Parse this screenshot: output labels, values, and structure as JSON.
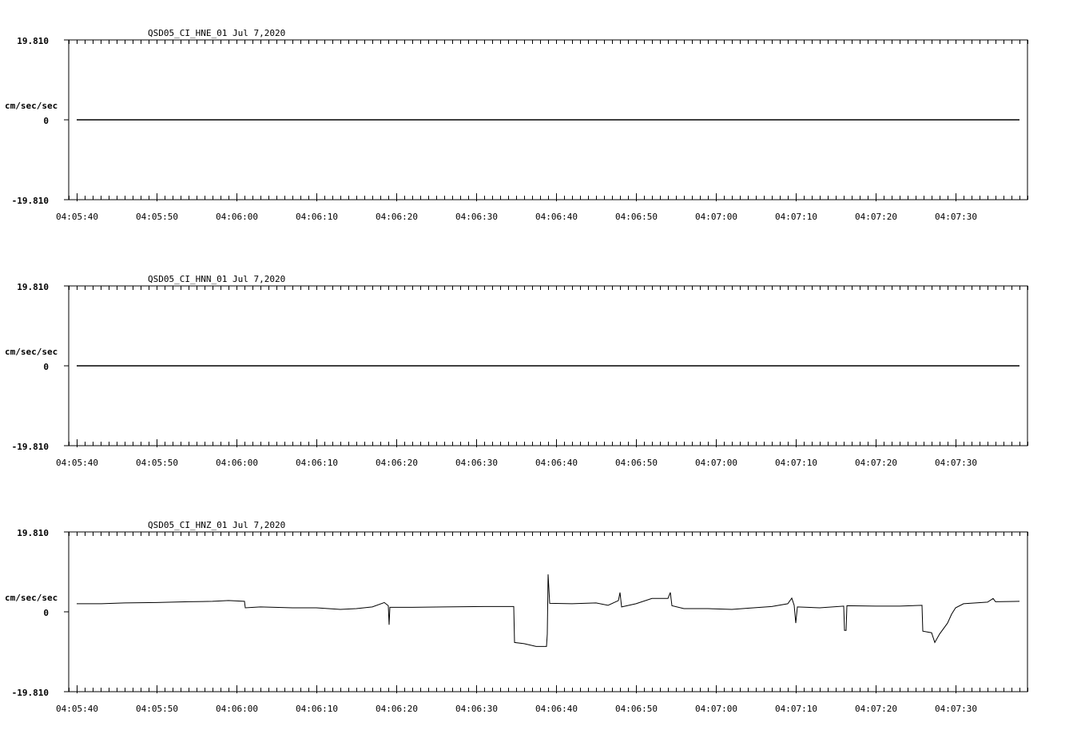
{
  "chart_data": [
    {
      "type": "line",
      "title": "QSD05_CI_HNE_01  Jul 7,2020",
      "ylabel": "cm/sec/sec",
      "ylim": [
        -19.81,
        19.81
      ],
      "ytick_labels": [
        "19.810",
        "0",
        "-19.810"
      ],
      "xlim_seconds": [
        -1,
        119
      ],
      "x_tick_labels": [
        "04:05:40",
        "04:05:50",
        "04:06:00",
        "04:06:10",
        "04:06:20",
        "04:06:30",
        "04:06:40",
        "04:06:50",
        "04:07:00",
        "04:07:10",
        "04:07:20",
        "04:07:30"
      ],
      "series": [
        {
          "points": [
            [
              0,
              0
            ],
            [
              118,
              0
            ]
          ]
        }
      ]
    },
    {
      "type": "line",
      "title": "QSD05_CI_HNN_01  Jul 7,2020",
      "ylabel": "cm/sec/sec",
      "ylim": [
        -19.81,
        19.81
      ],
      "ytick_labels": [
        "19.810",
        "0",
        "-19.810"
      ],
      "xlim_seconds": [
        -1,
        119
      ],
      "x_tick_labels": [
        "04:05:40",
        "04:05:50",
        "04:06:00",
        "04:06:10",
        "04:06:20",
        "04:06:30",
        "04:06:40",
        "04:06:50",
        "04:07:00",
        "04:07:10",
        "04:07:20",
        "04:07:30"
      ],
      "series": [
        {
          "points": [
            [
              0,
              0
            ],
            [
              118,
              0
            ]
          ]
        }
      ]
    },
    {
      "type": "line",
      "title": "QSD05_CI_HNZ_01  Jul 7,2020",
      "ylabel": "cm/sec/sec",
      "ylim": [
        -19.81,
        19.81
      ],
      "ytick_labels": [
        "19.810",
        "0",
        "-19.810"
      ],
      "xlim_seconds": [
        -1,
        119
      ],
      "x_tick_labels": [
        "04:05:40",
        "04:05:50",
        "04:06:00",
        "04:06:10",
        "04:06:20",
        "04:06:30",
        "04:06:40",
        "04:06:50",
        "04:07:00",
        "04:07:10",
        "04:07:20",
        "04:07:30"
      ],
      "series": [
        {
          "points": [
            [
              0,
              2.0
            ],
            [
              3,
              2.0
            ],
            [
              6,
              2.2
            ],
            [
              10,
              2.3
            ],
            [
              14,
              2.5
            ],
            [
              17,
              2.6
            ],
            [
              19,
              2.8
            ],
            [
              21,
              2.6
            ],
            [
              21.1,
              1.0
            ],
            [
              23,
              1.2
            ],
            [
              27,
              1.0
            ],
            [
              30,
              1.0
            ],
            [
              33,
              0.6
            ],
            [
              35,
              0.8
            ],
            [
              37,
              1.2
            ],
            [
              38.5,
              2.3
            ],
            [
              39,
              1.5
            ],
            [
              39.1,
              -3.2
            ],
            [
              39.2,
              1.1
            ],
            [
              42,
              1.1
            ],
            [
              46,
              1.2
            ],
            [
              51,
              1.3
            ],
            [
              54.7,
              1.3
            ],
            [
              54.8,
              -7.6
            ],
            [
              56,
              -7.9
            ],
            [
              57.5,
              -8.6
            ],
            [
              58.8,
              -8.6
            ],
            [
              58.9,
              -5.5
            ],
            [
              59,
              9.3
            ],
            [
              59.2,
              2.1
            ],
            [
              62,
              2.0
            ],
            [
              65,
              2.2
            ],
            [
              66.5,
              1.6
            ],
            [
              67.8,
              2.8
            ],
            [
              68,
              4.8
            ],
            [
              68.2,
              1.2
            ],
            [
              70,
              2.0
            ],
            [
              72,
              3.3
            ],
            [
              74,
              3.3
            ],
            [
              74.3,
              4.8
            ],
            [
              74.5,
              1.5
            ],
            [
              76,
              0.8
            ],
            [
              79,
              0.8
            ],
            [
              82,
              0.6
            ],
            [
              84,
              0.9
            ],
            [
              87,
              1.3
            ],
            [
              89,
              2.0
            ],
            [
              89.5,
              3.4
            ],
            [
              89.8,
              1.6
            ],
            [
              90,
              -2.8
            ],
            [
              90.2,
              1.2
            ],
            [
              93,
              1.0
            ],
            [
              96,
              1.4
            ],
            [
              96.1,
              -4.6
            ],
            [
              96.3,
              -4.6
            ],
            [
              96.4,
              1.5
            ],
            [
              100,
              1.4
            ],
            [
              103,
              1.4
            ],
            [
              105.8,
              1.6
            ],
            [
              105.9,
              -4.8
            ],
            [
              107,
              -5.2
            ],
            [
              107.4,
              -7.6
            ],
            [
              108,
              -5.5
            ],
            [
              109,
              -2.8
            ],
            [
              109.5,
              -0.6
            ],
            [
              110,
              1.0
            ],
            [
              111,
              2.0
            ],
            [
              114,
              2.4
            ],
            [
              114.7,
              3.3
            ],
            [
              115,
              2.5
            ],
            [
              118,
              2.6
            ]
          ]
        }
      ]
    }
  ]
}
